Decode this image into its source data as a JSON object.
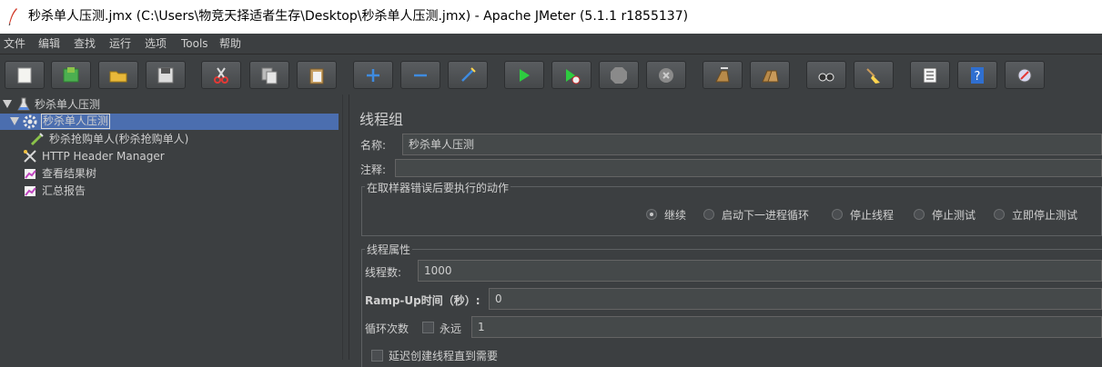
{
  "window": {
    "title": "秒杀单人压测.jmx (C:\\Users\\物竞天择适者生存\\Desktop\\秒杀单人压测.jmx) - Apache JMeter (5.1.1 r1855137)"
  },
  "menu": [
    "文件",
    "编辑",
    "查找",
    "运行",
    "选项",
    "Tools",
    "帮助"
  ],
  "toolbar": [
    "new-icon",
    "templates-icon",
    "open-icon",
    "save-icon",
    "cut-icon",
    "copy-icon",
    "paste-icon",
    "expand-plus-icon",
    "collapse-minus-icon",
    "toggle-wand-icon",
    "start-icon",
    "start-no-pause-icon",
    "stop-icon",
    "shutdown-icon",
    "clear-icon",
    "clear-all-icon",
    "search-binoculars-icon",
    "reset-search-broom-icon",
    "function-helper-icon",
    "help-icon",
    "remote-icon"
  ],
  "tree": {
    "root": "秒杀单人压测",
    "thread_group": "秒杀单人压测",
    "sampler": "秒杀抢购单人(秒杀抢购单人)",
    "header_manager": "HTTP Header Manager",
    "results_tree": "查看结果树",
    "summary_report": "汇总报告"
  },
  "panel": {
    "heading": "线程组",
    "name_label": "名称:",
    "name_value": "秒杀单人压测",
    "comment_label": "注释:",
    "comment_value": "",
    "error_group_title": "在取样器错误后要执行的动作",
    "error_actions": [
      "继续",
      "启动下一进程循环",
      "停止线程",
      "停止测试",
      "立即停止测试"
    ],
    "selected_action_index": 0,
    "thread_props_title": "线程属性",
    "threads_label": "线程数:",
    "threads_value": "1000",
    "rampup_label": "Ramp-Up时间（秒）:",
    "rampup_value": "0",
    "loop_label": "循环次数",
    "forever_label": "永远",
    "loop_value": "1",
    "delay_label": "延迟创建线程直到需要"
  },
  "colors": {
    "background": "#3c3f41",
    "selection": "#4b6eaf",
    "field": "#45494a"
  }
}
